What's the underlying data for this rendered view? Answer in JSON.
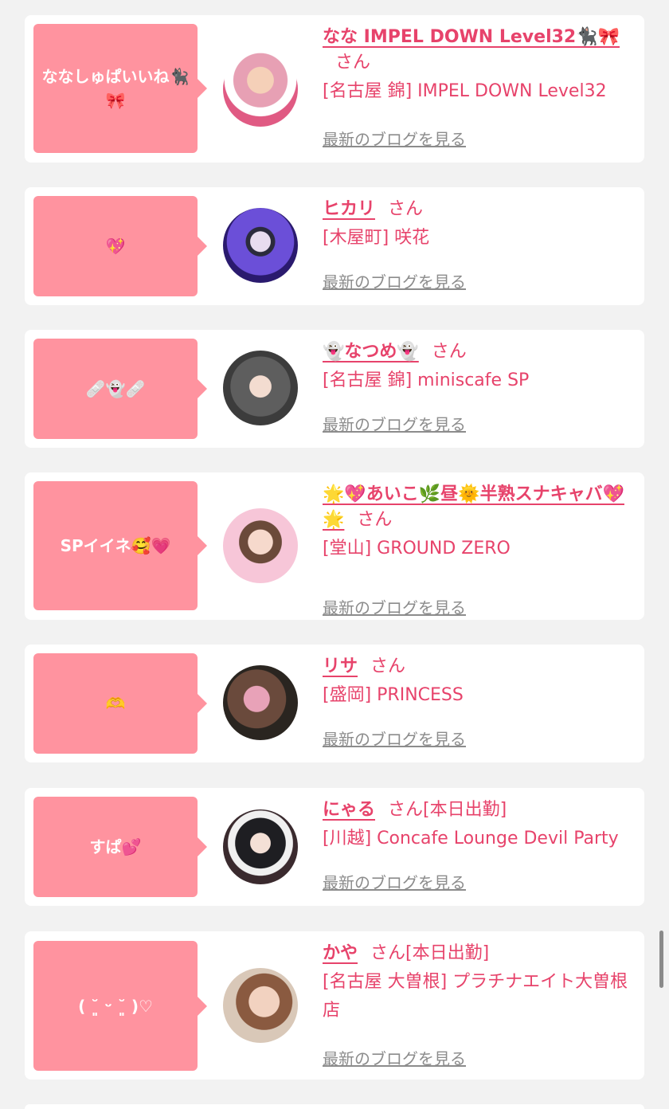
{
  "colors": {
    "accent": "#e7436b",
    "bubble": "#ff939f",
    "link_gray": "#8c8c8c",
    "background": "#f2f2f2"
  },
  "entries": [
    {
      "message": "ななしゅぱいいね🐈‍⬛🎀",
      "name": "なな IMPEL DOWN Level32🐈‍⬛🎀",
      "suffix": "さん",
      "badge": "",
      "shop": "[名古屋 錦] IMPEL DOWN Level32",
      "blog_link": "最新のブログを見る"
    },
    {
      "message": "💖",
      "name": "ヒカリ",
      "suffix": "さん",
      "badge": "",
      "shop": "[木屋町] 咲花",
      "blog_link": "最新のブログを見る"
    },
    {
      "message": "🩹👻🩹",
      "name": "👻なつめ👻",
      "suffix": "さん",
      "badge": "",
      "shop": "[名古屋 錦] miniscafe SP",
      "blog_link": "最新のブログを見る"
    },
    {
      "message": "SPイイネ🥰💗",
      "name": "🌟💖あいこ🌿昼🌞半熟スナキャバ💖🌟",
      "suffix": "さん",
      "badge": "",
      "shop": "[堂山] GROUND ZERO",
      "blog_link": "最新のブログを見る"
    },
    {
      "message": "🫶",
      "name": "リサ",
      "suffix": "さん",
      "badge": "",
      "shop": "[盛岡] PRINCESS",
      "blog_link": "最新のブログを見る"
    },
    {
      "message": "すぱ💕",
      "name": "にゃる",
      "suffix": "さん",
      "badge": "[本日出勤]",
      "shop": "[川越] Concafe Lounge Devil Party",
      "blog_link": "最新のブログを見る"
    },
    {
      "message": "( ˘͈ ᵕ ˘͈ )♡",
      "name": "かや",
      "suffix": "さん",
      "badge": "[本日出勤]",
      "shop": "[名古屋 大曽根] プラチナエイト大曽根店",
      "blog_link": "最新のブログを見る"
    }
  ]
}
